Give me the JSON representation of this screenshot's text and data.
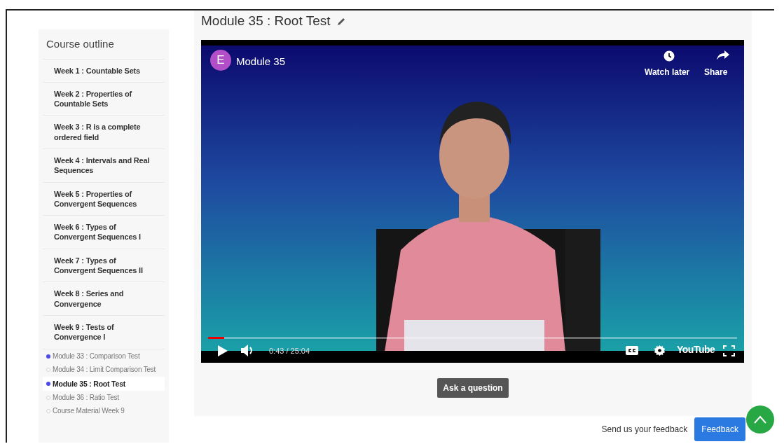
{
  "sidebar": {
    "title": "Course outline",
    "items": [
      {
        "label": "Week 1 : Countable Sets"
      },
      {
        "label": "Week 2 : Properties of Countable Sets"
      },
      {
        "label": "Week 3 : R is a complete ordered field"
      },
      {
        "label": "Week 4 : Intervals and Real Sequences"
      },
      {
        "label": "Week 5 : Properties of Convergent Sequences"
      },
      {
        "label": "Week 6 : Types of Convergent Sequences I"
      },
      {
        "label": "Week 7 : Types of Convergent Sequences II"
      },
      {
        "label": "Week 8 : Series and Convergence"
      },
      {
        "label": "Week 9 : Tests of Convergence I",
        "children": [
          {
            "label": "Module 33 : Comparison Test",
            "completed": true,
            "selected": false
          },
          {
            "label": "Module 34 : Limit Comparison Test",
            "completed": false,
            "selected": false
          },
          {
            "label": "Module 35 : Root Test",
            "completed": true,
            "selected": true
          },
          {
            "label": "Module 36 : Ratio Test",
            "completed": false,
            "selected": false
          },
          {
            "label": "Course Material Week 9",
            "completed": false,
            "selected": false
          }
        ]
      }
    ]
  },
  "main": {
    "title": "Module 35 : Root Test",
    "video": {
      "avatar": "E",
      "title": "Module 35",
      "watch_later": "Watch later",
      "share": "Share",
      "time": "0:43 / 25:04",
      "level": 0.03,
      "brand": "YouTube"
    },
    "ask_button": "Ask a question"
  },
  "footer": {
    "feedback_text": "Send us your feedback",
    "feedback_button": "Feedback"
  }
}
